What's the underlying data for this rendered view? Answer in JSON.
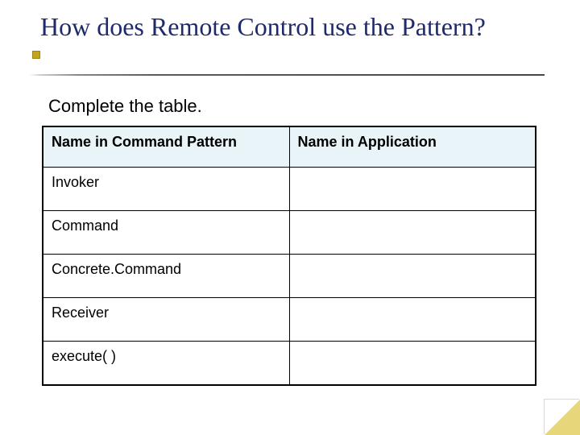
{
  "title": "How does Remote Control use the Pattern?",
  "subtitle": "Complete the table.",
  "table": {
    "headers": {
      "left": "Name in Command Pattern",
      "right": "Name in Application"
    },
    "rows": [
      {
        "left": "Invoker",
        "right": ""
      },
      {
        "left": "Command",
        "right": ""
      },
      {
        "left": "Concrete.Command",
        "right": ""
      },
      {
        "left": "Receiver",
        "right": ""
      },
      {
        "left": "execute( )",
        "right": ""
      }
    ]
  }
}
